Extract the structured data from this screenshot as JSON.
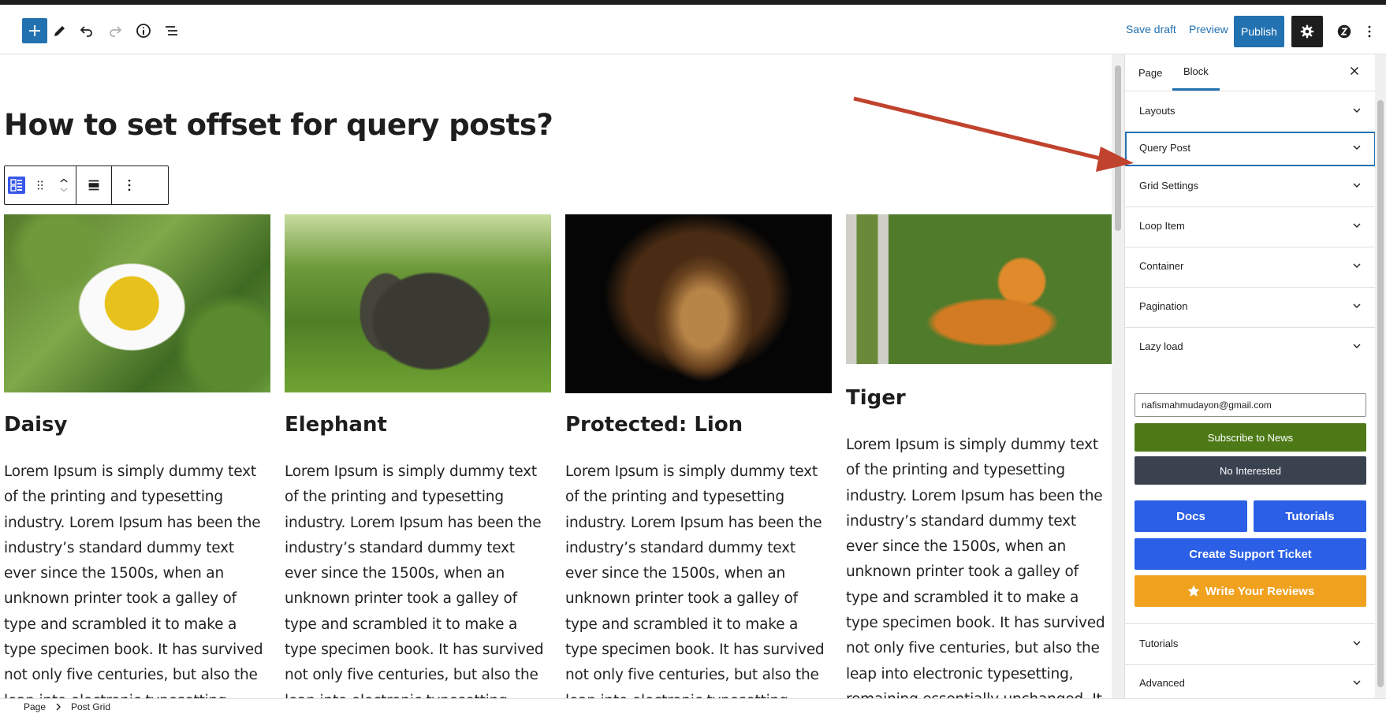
{
  "header": {
    "save_draft": "Save draft",
    "preview": "Preview",
    "publish": "Publish"
  },
  "content": {
    "title": "How to set offset for query posts?",
    "posts": [
      {
        "title": "Daisy",
        "excerpt": "Lorem Ipsum is simply dummy text of the printing and typesetting industry. Lorem Ipsum has been the industry’s standard dummy text ever since the 1500s, when an unknown printer took a galley of type and scrambled it to make a type specimen book. It has survived not only five centuries, but also the leap into electronic typesetting, remaining essentially"
      },
      {
        "title": "Elephant",
        "excerpt": "Lorem Ipsum is simply dummy text of the printing and typesetting industry. Lorem Ipsum has been the industry’s standard dummy text ever since the 1500s, when an unknown printer took a galley of type and scrambled it to make a type specimen book. It has survived not only five centuries, but also the leap into electronic typesetting, remaining essentially"
      },
      {
        "title": "Protected: Lion",
        "excerpt": "Lorem Ipsum is simply dummy text of the printing and typesetting industry. Lorem Ipsum has been the industry’s standard dummy text ever since the 1500s, when an unknown printer took a galley of type and scrambled it to make a type specimen book. It has survived not only five centuries, but also the leap into electronic typesetting, remaining essentially"
      },
      {
        "title": "Tiger",
        "excerpt": "Lorem Ipsum is simply dummy text of the printing and typesetting industry. Lorem Ipsum has been the industry’s standard dummy text ever since the 1500s, when an unknown printer took a galley of type and scrambled it to make a type specimen book. It has survived not only five centuries, but also the leap into electronic typesetting, remaining essentially unchanged. It was popularised in the"
      }
    ]
  },
  "sidebar": {
    "tabs": [
      "Page",
      "Block"
    ],
    "active_tab": "Block",
    "panels": [
      "Layouts",
      "Query Post",
      "Grid Settings",
      "Loop Item",
      "Container",
      "Pagination",
      "Lazy load"
    ],
    "email_value": "nafismahmudayon@gmail.com",
    "subscribe": "Subscribe to News",
    "not_interested": "No Interested",
    "docs": "Docs",
    "tutorials_btn": "Tutorials",
    "support": "Create Support Ticket",
    "review": "Write Your Reviews",
    "bottom_panels": [
      "Tutorials",
      "Advanced"
    ]
  },
  "footer": {
    "crumbs": [
      "Page",
      "Post Grid"
    ]
  },
  "colors": {
    "accent": "#2271b1",
    "subscribe": "#4d7a17",
    "dark_button": "#3a4250",
    "blue_button": "#2a5fe6",
    "review_button": "#f0a11e",
    "annotation_arrow": "#c0432e"
  }
}
